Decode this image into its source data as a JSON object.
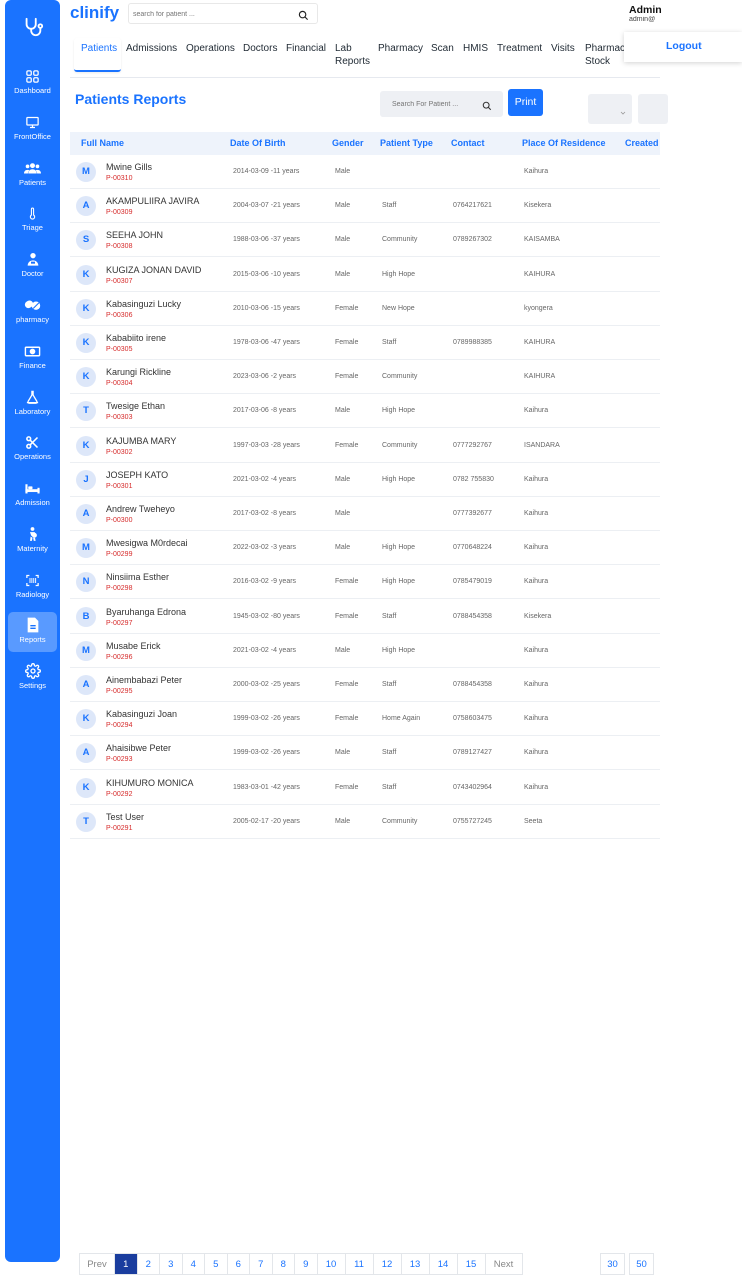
{
  "brand": "clinify",
  "top_search": {
    "placeholder": "search for patient ..."
  },
  "user": {
    "name": "Admin",
    "email": "admin@"
  },
  "logout_label": "Logout",
  "sidebar": {
    "items": [
      {
        "label": "Dashboard",
        "icon": "dashboard-icon"
      },
      {
        "label": "FrontOffice",
        "icon": "monitor-icon"
      },
      {
        "label": "Patients",
        "icon": "users-icon"
      },
      {
        "label": "Triage",
        "icon": "thermometer-icon"
      },
      {
        "label": "Doctor",
        "icon": "doctor-icon"
      },
      {
        "label": "pharmacy",
        "icon": "pills-icon"
      },
      {
        "label": "Finance",
        "icon": "money-icon"
      },
      {
        "label": "Laboratory",
        "icon": "flask-icon"
      },
      {
        "label": "Operations",
        "icon": "scissors-icon"
      },
      {
        "label": "Admission",
        "icon": "bed-icon"
      },
      {
        "label": "Maternity",
        "icon": "maternity-icon"
      },
      {
        "label": "Radiology",
        "icon": "scan-icon"
      },
      {
        "label": "Reports",
        "icon": "report-icon",
        "active": true
      },
      {
        "label": "Settings",
        "icon": "gear-icon"
      }
    ]
  },
  "tabs": [
    {
      "label": "Patients",
      "active": true
    },
    {
      "label": "Admissions"
    },
    {
      "label": "Operations"
    },
    {
      "label": "Doctors"
    },
    {
      "label": "Financial"
    },
    {
      "label": "Lab\nReports"
    },
    {
      "label": "Pharmacy"
    },
    {
      "label": "Scan"
    },
    {
      "label": "HMIS"
    },
    {
      "label": "Treatment"
    },
    {
      "label": "Visits"
    },
    {
      "label": "Pharmacy\nStock"
    }
  ],
  "page": {
    "title": "Patients Reports",
    "search_placeholder": "Search For Patient ...",
    "print_label": "Print"
  },
  "table": {
    "headers": [
      "Full Name",
      "Date Of Birth",
      "Gender",
      "Patient Type",
      "Contact",
      "Place Of Residence",
      "Created"
    ],
    "rows": [
      {
        "initial": "M",
        "name": "Mwine Gills",
        "id": "P-00310",
        "dob": "2014-03-09 -11 years",
        "gender": "Male",
        "type": "",
        "contact": "",
        "residence": "Kaihura"
      },
      {
        "initial": "A",
        "name": "AKAMPULIIRA JAVIRA",
        "id": "P-00309",
        "dob": "2004-03-07 -21 years",
        "gender": "Male",
        "type": "Staff",
        "contact": "0764217621",
        "residence": "Kisekera"
      },
      {
        "initial": "S",
        "name": "SEEHA JOHN",
        "id": "P-00308",
        "dob": "1988-03-06 -37 years",
        "gender": "Male",
        "type": "Community",
        "contact": "0789267302",
        "residence": "KAISAMBA"
      },
      {
        "initial": "K",
        "name": "KUGIZA JONAN DAVID",
        "id": "P-00307",
        "dob": "2015-03-06 -10 years",
        "gender": "Male",
        "type": "High Hope",
        "contact": "",
        "residence": "KAIHURA"
      },
      {
        "initial": "K",
        "name": "Kabasinguzi Lucky",
        "id": "P-00306",
        "dob": "2010-03-06 -15 years",
        "gender": "Female",
        "type": "New Hope",
        "contact": "",
        "residence": "kyongera"
      },
      {
        "initial": "K",
        "name": "Kababiito irene",
        "id": "P-00305",
        "dob": "1978-03-06 -47 years",
        "gender": "Female",
        "type": "Staff",
        "contact": "0789988385",
        "residence": "KAIHURA"
      },
      {
        "initial": "K",
        "name": "Karungi Rickline",
        "id": "P-00304",
        "dob": "2023-03-06 -2 years",
        "gender": "Female",
        "type": "Community",
        "contact": "",
        "residence": "KAIHURA"
      },
      {
        "initial": "T",
        "name": "Twesige Ethan",
        "id": "P-00303",
        "dob": "2017-03-06 -8 years",
        "gender": "Male",
        "type": "High Hope",
        "contact": "",
        "residence": "Kaihura"
      },
      {
        "initial": "K",
        "name": "KAJUMBA MARY",
        "id": "P-00302",
        "dob": "1997-03-03 -28 years",
        "gender": "Female",
        "type": "Community",
        "contact": "0777292767",
        "residence": "ISANDARA"
      },
      {
        "initial": "J",
        "name": "JOSEPH KATO",
        "id": "P-00301",
        "dob": "2021-03-02 -4 years",
        "gender": "Male",
        "type": "High Hope",
        "contact": "0782 755830",
        "residence": "Kaihura"
      },
      {
        "initial": "A",
        "name": "Andrew Tweheyo",
        "id": "P-00300",
        "dob": "2017-03-02 -8 years",
        "gender": "Male",
        "type": "",
        "contact": "0777392677",
        "residence": "Kaihura"
      },
      {
        "initial": "M",
        "name": "Mwesigwa M0rdecai",
        "id": "P-00299",
        "dob": "2022-03-02 -3 years",
        "gender": "Male",
        "type": "High Hope",
        "contact": "0770648224",
        "residence": "Kaihura"
      },
      {
        "initial": "N",
        "name": "Ninsiima Esther",
        "id": "P-00298",
        "dob": "2016-03-02 -9 years",
        "gender": "Female",
        "type": "High Hope",
        "contact": "0785479019",
        "residence": "Kaihura"
      },
      {
        "initial": "B",
        "name": "Byaruhanga Edrona",
        "id": "P-00297",
        "dob": "1945-03-02 -80 years",
        "gender": "Female",
        "type": "Staff",
        "contact": "0788454358",
        "residence": "Kisekera"
      },
      {
        "initial": "M",
        "name": "Musabe Erick",
        "id": "P-00296",
        "dob": "2021-03-02 -4 years",
        "gender": "Male",
        "type": "High Hope",
        "contact": "",
        "residence": "Kaihura"
      },
      {
        "initial": "A",
        "name": "Ainembabazi Peter",
        "id": "P-00295",
        "dob": "2000-03-02 -25 years",
        "gender": "Female",
        "type": "Staff",
        "contact": "0788454358",
        "residence": "Kaihura"
      },
      {
        "initial": "K",
        "name": "Kabasinguzi Joan",
        "id": "P-00294",
        "dob": "1999-03-02 -26 years",
        "gender": "Female",
        "type": "Home Again",
        "contact": "0758603475",
        "residence": "Kaihura"
      },
      {
        "initial": "A",
        "name": "Ahaisibwe Peter",
        "id": "P-00293",
        "dob": "1999-03-02 -26 years",
        "gender": "Male",
        "type": "Staff",
        "contact": "0789127427",
        "residence": "Kaihura"
      },
      {
        "initial": "K",
        "name": "KIHUMURO MONICA",
        "id": "P-00292",
        "dob": "1983-03-01 -42 years",
        "gender": "Female",
        "type": "Staff",
        "contact": "0743402964",
        "residence": "Kaihura"
      },
      {
        "initial": "T",
        "name": "Test User",
        "id": "P-00291",
        "dob": "2005-02-17 -20 years",
        "gender": "Male",
        "type": "Community",
        "contact": "0755727245",
        "residence": "Seeta"
      }
    ]
  },
  "pagination": {
    "prev": "Prev",
    "next": "Next",
    "pages": [
      "1",
      "2",
      "3",
      "4",
      "5",
      "6",
      "7",
      "8",
      "9",
      "10",
      "11",
      "12",
      "13",
      "14",
      "15"
    ],
    "current": "1",
    "page_sizes": [
      "30",
      "50"
    ]
  },
  "colors": {
    "accent": "#1a73ff",
    "id_red": "#d62c2c",
    "header_bg": "#eef3fb"
  }
}
